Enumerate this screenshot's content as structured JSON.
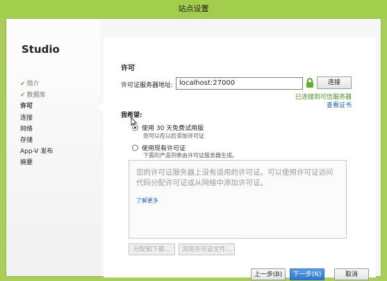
{
  "window": {
    "title": "站点设置"
  },
  "sidebar": {
    "title": "Studio",
    "items": [
      {
        "label": "简介",
        "done": true
      },
      {
        "label": "数据库",
        "done": true
      },
      {
        "label": "许可",
        "active": true
      },
      {
        "label": "连接"
      },
      {
        "label": "网络"
      },
      {
        "label": "存储"
      },
      {
        "label": "App-V 发布"
      },
      {
        "label": "摘要"
      }
    ]
  },
  "main": {
    "heading": "许可",
    "server_label": "许可证服务器地址:",
    "server_value": "localhost:27000",
    "connect_label": "连接",
    "connected_status": "已连接到可信服务器",
    "view_cert_label": "查看证书",
    "want_label": "我希望:",
    "options": [
      {
        "label": "使用 30 天免费试用版",
        "sub": "您可以在以后添加许可证",
        "checked": true
      },
      {
        "label": "使用现有许可证",
        "sub": "下面的产品列表由许可证服务器生成。",
        "checked": false
      }
    ],
    "message": "您的许可证服务器上没有适用的许可证。可以使用许可证访问代码分配许可证或从网络中添加许可证。",
    "learn_more": "了解更多",
    "alloc_label": "分配和下载...",
    "browse_label": "浏览许可证文件..."
  },
  "footer": {
    "back_label": "上一步(B)",
    "next_label": "下一步(N)",
    "cancel_label": "取消"
  },
  "colors": {
    "accent": "#a3cd4c",
    "primary_button": "#3a84d8",
    "success": "#4b8f22"
  }
}
